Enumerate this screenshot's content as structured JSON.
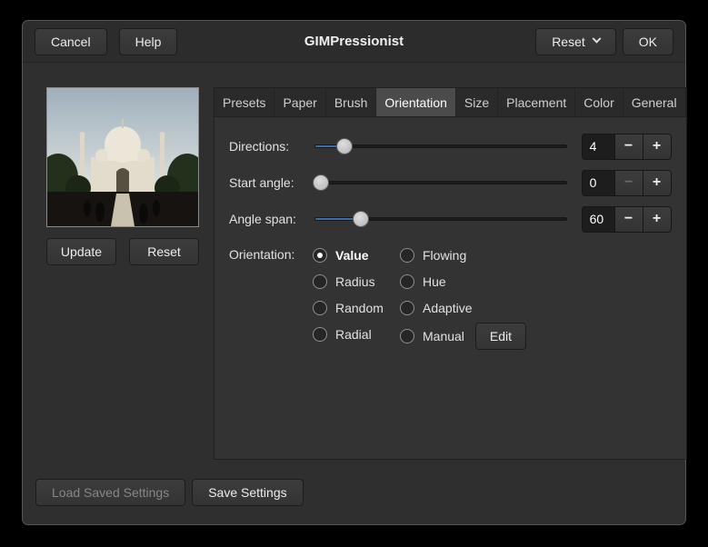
{
  "window": {
    "title": "GIMPressionist"
  },
  "header": {
    "cancel": "Cancel",
    "help": "Help",
    "reset": "Reset",
    "ok": "OK"
  },
  "preview": {
    "update": "Update",
    "reset": "Reset"
  },
  "tabs": [
    {
      "label": "Presets"
    },
    {
      "label": "Paper"
    },
    {
      "label": "Brush"
    },
    {
      "label": "Orientation"
    },
    {
      "label": "Size"
    },
    {
      "label": "Placement"
    },
    {
      "label": "Color"
    },
    {
      "label": "General"
    }
  ],
  "active_tab": "Orientation",
  "orientation": {
    "directions": {
      "label": "Directions:",
      "value": "4",
      "fraction": 0.1
    },
    "start_angle": {
      "label": "Start angle:",
      "value": "0",
      "fraction": 0.0
    },
    "angle_span": {
      "label": "Angle span:",
      "value": "60",
      "fraction": 0.17
    },
    "orientation_label": "Orientation:",
    "minus_label": "−",
    "plus_label": "+",
    "radio_columns": [
      {
        "items": [
          {
            "label": "Value",
            "selected": true
          },
          {
            "label": "Radius",
            "selected": false
          },
          {
            "label": "Random",
            "selected": false
          },
          {
            "label": "Radial",
            "selected": false
          }
        ]
      },
      {
        "items": [
          {
            "label": "Flowing",
            "selected": false
          },
          {
            "label": "Hue",
            "selected": false
          },
          {
            "label": "Adaptive",
            "selected": false
          },
          {
            "label": "Manual",
            "selected": false
          }
        ]
      }
    ],
    "edit": "Edit"
  },
  "footer": {
    "load": "Load Saved Settings",
    "save": "Save Settings"
  },
  "colors": {
    "dialog_bg": "#2f2f2f",
    "accent_blue": "#3a6ea5",
    "entry_bg": "#1d1d1d",
    "active_tab_bg": "#4b4b4b"
  }
}
